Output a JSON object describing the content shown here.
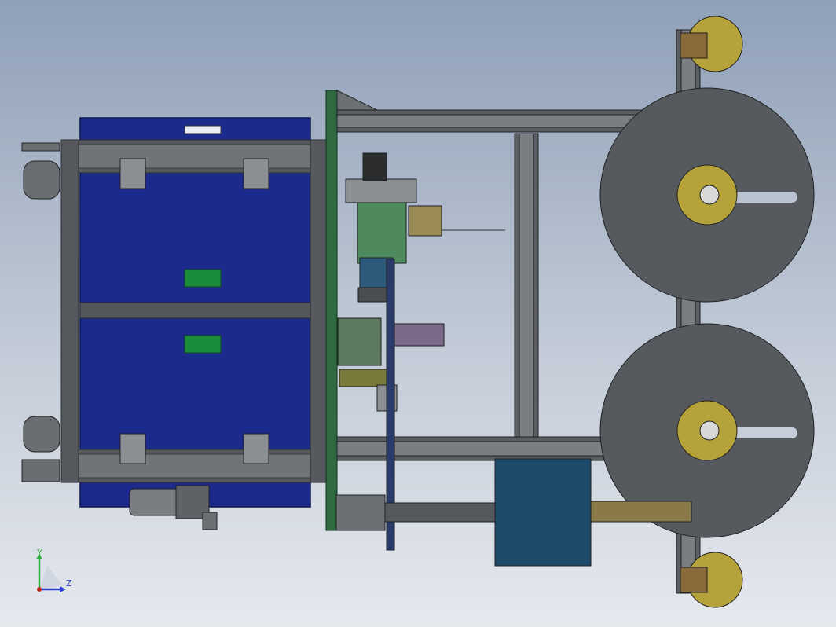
{
  "view": {
    "background_top": "#8fa0b8",
    "background_bottom": "#e6e9ee"
  },
  "triad": {
    "y_label": "Y",
    "z_label": "Z",
    "y_color": "#2eae3c",
    "z_color": "#2d3fcf",
    "x_color": "#c2251e"
  },
  "colors": {
    "cabinet": "#1c2a8c",
    "frame": "#4a4d50",
    "plate": "#2f6a40",
    "reel": "#565a5e",
    "hub": "#b5a23a",
    "box": "#1e4a6a",
    "label": "#1b8c3a"
  }
}
